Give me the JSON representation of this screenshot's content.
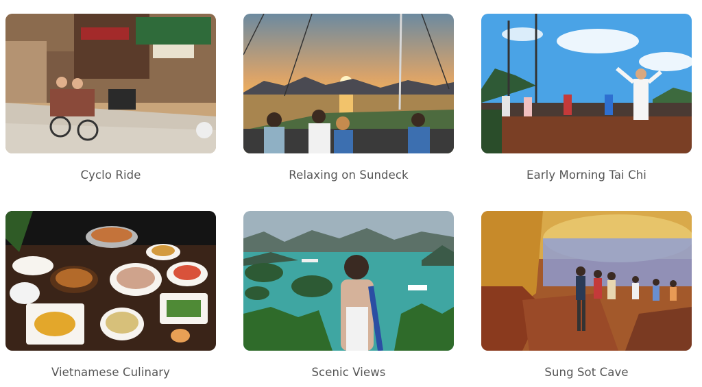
{
  "tours": [
    {
      "title": "Cyclo Ride",
      "image": "street-cyclo-photo"
    },
    {
      "title": "Relaxing on Sundeck",
      "image": "sunset-sundeck-photo"
    },
    {
      "title": "Early Morning Tai Chi",
      "image": "tai-chi-deck-photo"
    },
    {
      "title": "Vietnamese Culinary",
      "image": "food-spread-photo"
    },
    {
      "title": "Scenic Views",
      "image": "bay-view-photo"
    },
    {
      "title": "Sung Sot Cave",
      "image": "cave-interior-photo"
    }
  ]
}
